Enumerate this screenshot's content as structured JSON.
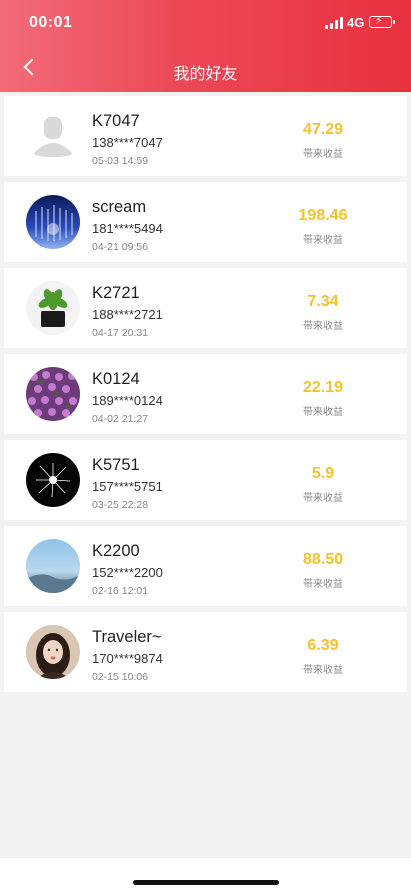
{
  "status_bar": {
    "time": "00:01",
    "network": "4G"
  },
  "header": {
    "title": "我的好友"
  },
  "friends": [
    {
      "name": "K7047",
      "phone": "138****7047",
      "date": "05-03 14:59",
      "amount": "47.29",
      "amount_label": "带来收益",
      "avatar": "default"
    },
    {
      "name": "scream",
      "phone": "181****5494",
      "date": "04-21 09:56",
      "amount": "198.46",
      "amount_label": "带来收益",
      "avatar": "night-lights"
    },
    {
      "name": "K2721",
      "phone": "188****2721",
      "date": "04-17 20:31",
      "amount": "7.34",
      "amount_label": "带来收益",
      "avatar": "potted-plant"
    },
    {
      "name": "K0124",
      "phone": "189****0124",
      "date": "04-02 21:27",
      "amount": "22.19",
      "amount_label": "带来收益",
      "avatar": "purple-flowers"
    },
    {
      "name": "K5751",
      "phone": "157****5751",
      "date": "03-25 22:28",
      "amount": "5.9",
      "amount_label": "带来收益",
      "avatar": "fireworks"
    },
    {
      "name": "K2200",
      "phone": "152****2200",
      "date": "02-16 12:01",
      "amount": "88.50",
      "amount_label": "带来收益",
      "avatar": "sky"
    },
    {
      "name": "Traveler~",
      "phone": "170****9874",
      "date": "02-15 10:06",
      "amount": "6.39",
      "amount_label": "带来收益",
      "avatar": "portrait"
    }
  ],
  "colors": {
    "header_start": "#f26b78",
    "header_end": "#e8313f",
    "amount": "#f5c12c"
  }
}
